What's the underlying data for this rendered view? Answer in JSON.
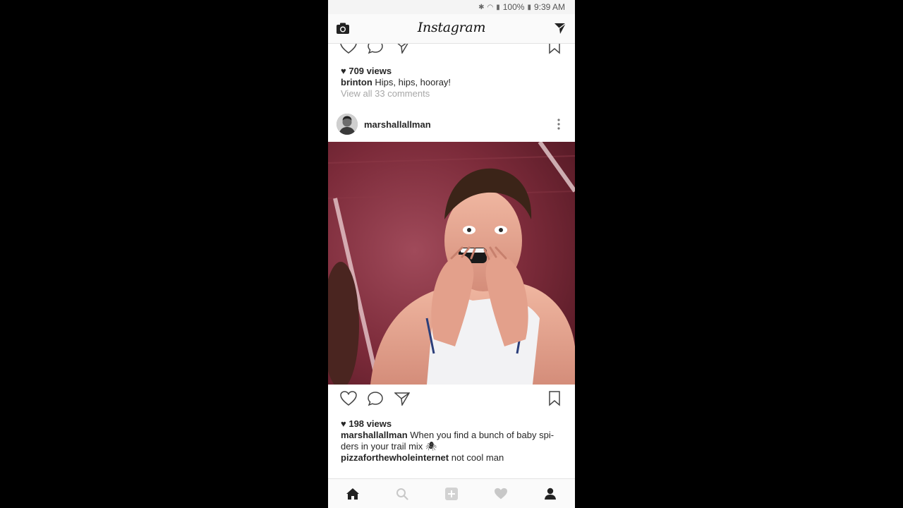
{
  "status_bar": {
    "battery": "100%",
    "time": "9:39 AM"
  },
  "app": {
    "title": "Instagram"
  },
  "icons": {
    "camera": "camera-icon",
    "direct": "send-icon",
    "like": "heart-icon",
    "comment": "comment-icon",
    "share": "send-icon",
    "save": "bookmark-icon",
    "home": "home-icon",
    "search": "search-icon",
    "add": "plus-square-icon",
    "activity": "heart-icon",
    "profile": "person-icon"
  },
  "prev_post": {
    "views": "709 views",
    "caption_user": "brinton",
    "caption_text": " Hips, hips, hooray!",
    "view_comments": "View all 33 comments"
  },
  "post": {
    "username": "marshallallman",
    "views": "198 views",
    "caption_user": "marshallallman",
    "caption_text": " When you find a bunch of baby spi-",
    "caption_text_2": "ders in your trail mix 🕷",
    "comment_user": "pizzaforthewholeinternet",
    "comment_text": " not cool man"
  },
  "colors": {
    "text": "#262626",
    "muted": "#a7a7a7",
    "background": "#ffffff",
    "bar": "#fafafa"
  }
}
